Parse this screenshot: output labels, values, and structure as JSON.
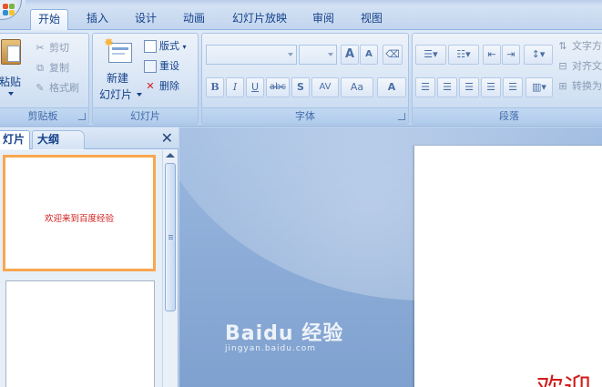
{
  "tabs": [
    {
      "label": "开始",
      "active": true
    },
    {
      "label": "插入"
    },
    {
      "label": "设计"
    },
    {
      "label": "动画"
    },
    {
      "label": "幻灯片放映"
    },
    {
      "label": "审阅"
    },
    {
      "label": "视图"
    }
  ],
  "clipboard": {
    "title": "剪贴板",
    "paste": "粘贴",
    "cut": "剪切",
    "copy": "复制",
    "format_painter": "格式刷"
  },
  "slides_group": {
    "title": "幻灯片",
    "new_slide_line1": "新建",
    "new_slide_line2": "幻灯片",
    "layout": "版式",
    "reset": "重设",
    "delete": "删除"
  },
  "font_group": {
    "title": "字体",
    "bold": "B",
    "italic": "I",
    "underline": "U",
    "strike": "abc",
    "shadow": "S",
    "spacing": "AV",
    "case": "Aa",
    "color": "A",
    "grow": "A",
    "shrink": "A"
  },
  "paragraph_group": {
    "title": "段落",
    "text_direction": "文字方",
    "align_text": "对齐文",
    "convert": "转换为"
  },
  "pane": {
    "tab_slides": "灯片",
    "tab_outline": "大纲",
    "close": "✕"
  },
  "slide1": {
    "text": "欢迎来到百度经验"
  },
  "main": {
    "slide_text": "欢迎"
  },
  "watermark": {
    "line1": "Baidu 经验",
    "line2": "jingyan.baidu.com"
  }
}
